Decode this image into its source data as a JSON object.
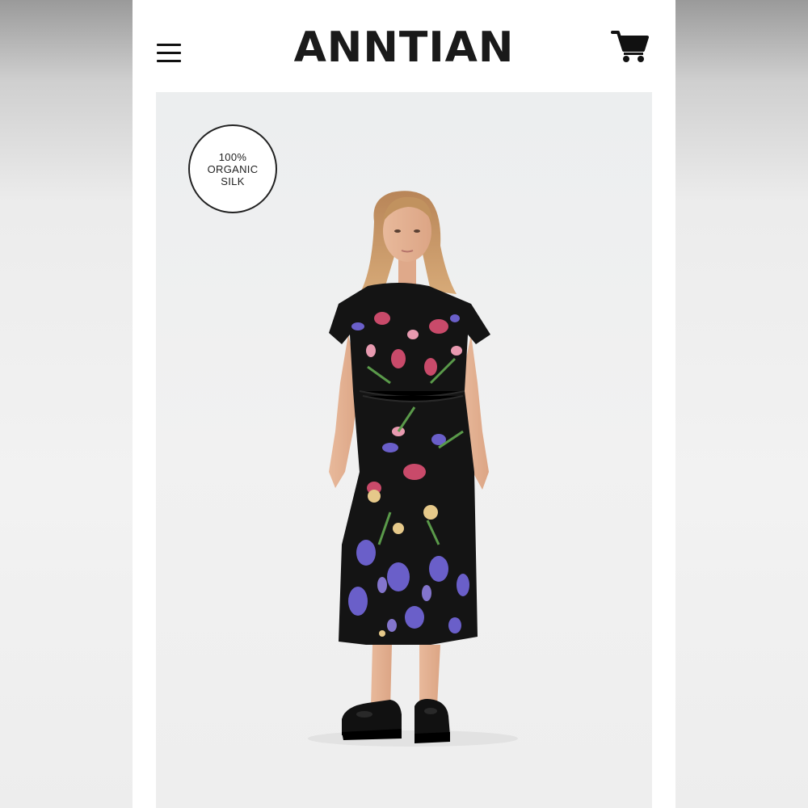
{
  "header": {
    "brand": "ANNTIAN",
    "menu_icon": "hamburger-menu-icon",
    "cart_icon": "shopping-cart-icon"
  },
  "product_image": {
    "badge_text": "100%\nORGANIC\nSILK",
    "subject": "model-wearing-floral-midi-dress"
  },
  "colors": {
    "background": "#ffffff",
    "text": "#1a1a1a",
    "dress": "#141414",
    "photo_bg": "#eeeeee"
  }
}
